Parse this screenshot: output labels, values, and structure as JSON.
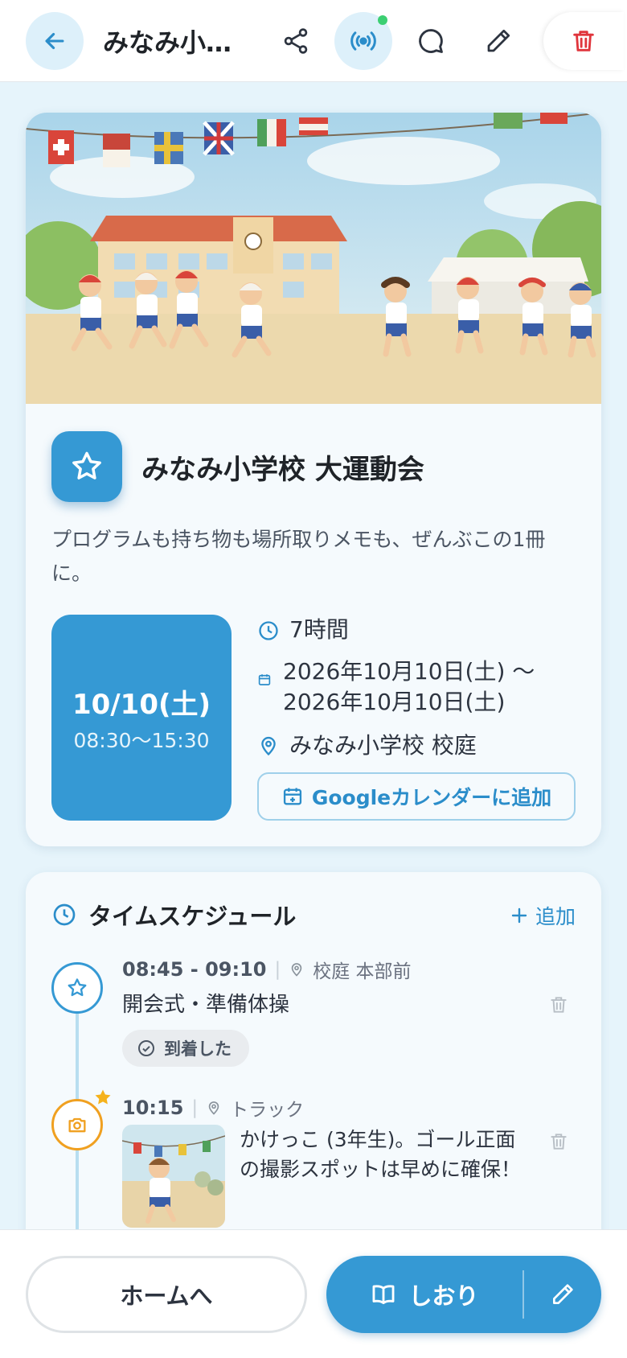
{
  "header": {
    "title": "みなみ小…",
    "icons": [
      "arrow-left-icon",
      "share-icon",
      "broadcast-icon",
      "chat-icon",
      "pencil-icon",
      "trash-icon"
    ],
    "live_indicator_color": "#3ccf72"
  },
  "event": {
    "name": "みなみ小学校 大運動会",
    "description": "プログラムも持ち物も場所取りメモも、ぜんぶこの1冊に。",
    "date_label": "10/10(土)",
    "time_range": "08:30〜15:30",
    "duration": "7時間",
    "date_span": "2026年10月10日(土) 〜 2026年10月10日(土)",
    "location": "みなみ小学校 校庭",
    "gcal_label": "Googleカレンダーに追加"
  },
  "schedule": {
    "title": "タイムスケジュール",
    "add_label": "追加",
    "items": [
      {
        "time": "08:45 - 09:10",
        "place": "校庭 本部前",
        "title": "開会式・準備体操",
        "status": "到着した",
        "icon": "star-icon"
      },
      {
        "time": "10:15",
        "place": "トラック",
        "note": "かけっこ (3年生)。ゴール正面の撮影スポットは早めに確保！",
        "icon": "camera-icon",
        "starred": true
      }
    ]
  },
  "bottom": {
    "home_label": "ホームへ",
    "shiori_label": "しおり"
  },
  "colors": {
    "accent": "#3599d4",
    "background": "#e6f4fb",
    "danger": "#e0353c",
    "highlight": "#f0a020"
  }
}
